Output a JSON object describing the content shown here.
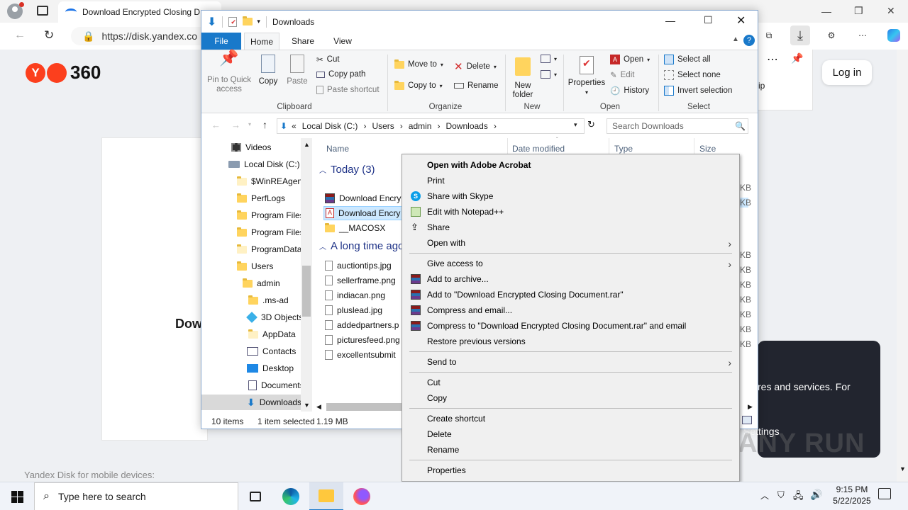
{
  "browser": {
    "tab_title": "Download Encrypted Closing D",
    "url": "https://disk.yandex.co",
    "window_controls": [
      "—",
      "❐",
      "✕"
    ]
  },
  "yandex": {
    "logo_text": "360",
    "login_label": "Log in",
    "card_text": "Dow",
    "mobile_text": "Yandex Disk for mobile devices:",
    "downloads_panel_text": "ip",
    "cookie_text": "res and services. For",
    "cookie_settings": "Settings",
    "watermark": "ANY RUN"
  },
  "explorer": {
    "title": "Downloads",
    "tabs": [
      "File",
      "Home",
      "Share",
      "View"
    ],
    "ribbon": {
      "clipboard": {
        "label": "Clipboard",
        "pin": "Pin to Quick access",
        "copy": "Copy",
        "paste": "Paste",
        "cut": "Cut",
        "copy_path": "Copy path",
        "paste_shortcut": "Paste shortcut"
      },
      "organize": {
        "label": "Organize",
        "move_to": "Move to",
        "copy_to": "Copy to",
        "delete": "Delete",
        "rename": "Rename"
      },
      "new": {
        "label": "New",
        "new_folder": "New folder"
      },
      "open": {
        "label": "Open",
        "properties": "Properties",
        "open": "Open",
        "edit": "Edit",
        "history": "History"
      },
      "select": {
        "label": "Select",
        "select_all": "Select all",
        "select_none": "Select none",
        "invert": "Invert selection"
      }
    },
    "breadcrumb": [
      "Local Disk (C:)",
      "Users",
      "admin",
      "Downloads"
    ],
    "breadcrumb_prefix": "«",
    "search_placeholder": "Search Downloads",
    "nav_items": [
      "Videos",
      "Local Disk (C:)",
      "$WinREAgent",
      "PerfLogs",
      "Program Files",
      "Program Files",
      "ProgramData",
      "Users",
      "admin",
      ".ms-ad",
      "3D Objects",
      "AppData",
      "Contacts",
      "Desktop",
      "Documents",
      "Downloads"
    ],
    "columns": [
      "Name",
      "Date modified",
      "Type",
      "Size"
    ],
    "groups": [
      "Today (3)",
      "A long time ago"
    ],
    "today_files": [
      "Download Encry",
      "Download Encry",
      "__MACOSX"
    ],
    "old_files": [
      "auctiontips.jpg",
      "sellerframe.png",
      "indiacan.png",
      "pluslead.jpg",
      "addedpartners.p",
      "picturesfeed.png",
      "excellentsubmit"
    ],
    "size_suffix": "KB",
    "status": {
      "items": "10 items",
      "selected": "1 item selected",
      "size": "1.19 MB"
    }
  },
  "context_menu": {
    "items": [
      {
        "label": "Open with Adobe Acrobat",
        "bold": true
      },
      {
        "label": "Print"
      },
      {
        "label": "Share with Skype",
        "icon": "skype-icon"
      },
      {
        "label": "Edit with Notepad++",
        "icon": "notepad-plus-plus-icon"
      },
      {
        "label": "Share",
        "icon": "share-icon"
      },
      {
        "label": "Open with",
        "submenu": true
      },
      {
        "label": "Give access to",
        "submenu": true
      },
      {
        "label": "Add to archive...",
        "icon": "winrar-icon"
      },
      {
        "label": "Add to \"Download Encrypted Closing Document.rar\"",
        "icon": "winrar-icon"
      },
      {
        "label": "Compress and email...",
        "icon": "winrar-icon"
      },
      {
        "label": "Compress to \"Download Encrypted Closing Document.rar\" and email",
        "icon": "winrar-icon"
      },
      {
        "label": "Restore previous versions"
      },
      {
        "label": "Send to",
        "submenu": true
      },
      {
        "label": "Cut"
      },
      {
        "label": "Copy"
      },
      {
        "label": "Create shortcut"
      },
      {
        "label": "Delete"
      },
      {
        "label": "Rename"
      },
      {
        "label": "Properties"
      }
    ]
  },
  "taskbar": {
    "search_placeholder": "Type here to search",
    "time": "9:15 PM",
    "date": "5/22/2025"
  },
  "colors": {
    "accent": "#1979ca",
    "selection": "#cce8ff",
    "cookie_bg": "#22252f",
    "yandex_red": "#fc3f1d"
  }
}
